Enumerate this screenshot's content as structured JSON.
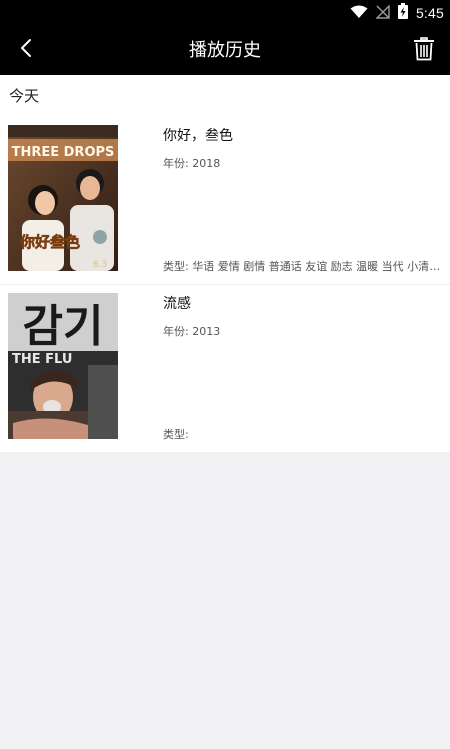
{
  "status_bar": {
    "time": "5:45",
    "icons": [
      "wifi-icon",
      "no-signal-icon",
      "battery-charging-icon"
    ]
  },
  "app_bar": {
    "title": "播放历史",
    "back_icon": "chevron-left-icon",
    "delete_icon": "trash-icon"
  },
  "history": {
    "section_label": "今天",
    "items": [
      {
        "title": "你好，叁色",
        "year": "年份: 2018",
        "genre": "类型: 华语 爱情 剧情 普通话 友谊 励志 温暖 当代 小清新 网络电影",
        "poster": {
          "banner_text": "THREE DROPS",
          "logo_text": "你好叁色",
          "badge_text": "6.3",
          "dominant_color": "#5a3b28"
        }
      },
      {
        "title": "流感",
        "year": "年份: 2013",
        "genre": "类型:",
        "poster": {
          "banner_text": "감기",
          "subtitle_text": "THE FLU",
          "dominant_color": "#3a3a3a"
        }
      }
    ]
  },
  "colors": {
    "bar_background": "#000000",
    "page_background": "#f2f2f4",
    "list_background": "#ffffff"
  }
}
